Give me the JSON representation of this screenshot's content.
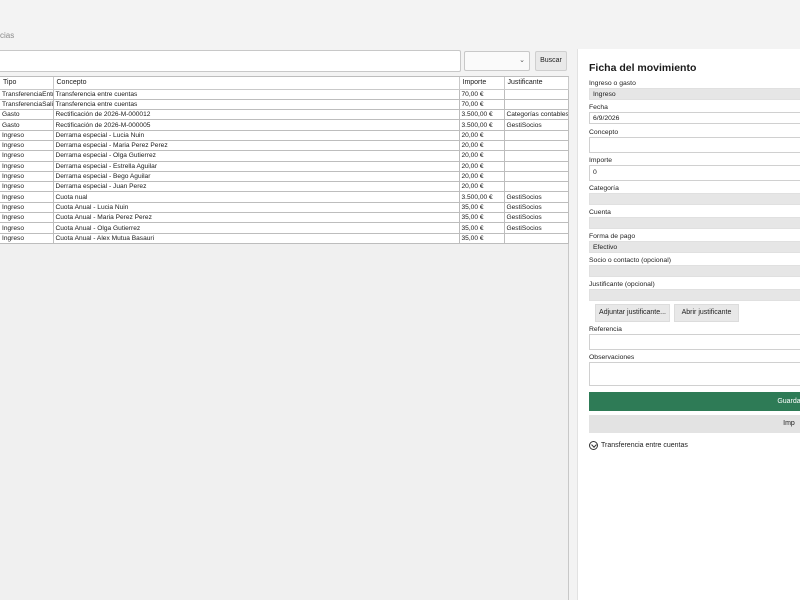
{
  "breadcrumb": "cias",
  "search": {
    "placeholder": "",
    "button": "Buscar",
    "filter_value": ""
  },
  "table": {
    "columns": [
      "Tipo",
      "Concepto",
      "Importe",
      "Justificante"
    ],
    "rows": [
      [
        "TransferenciaEntr",
        "Transferencia entre cuentas",
        "70,00 €",
        ""
      ],
      [
        "TransferenciaSalid",
        "Transferencia entre cuentas",
        "70,00 €",
        ""
      ],
      [
        "Gasto",
        "Rectificación de 2026-M-000012",
        "3.500,00 €",
        "Categorías contables"
      ],
      [
        "Gasto",
        "Rectificación de 2026-M-000005",
        "3.500,00 €",
        "GestiSocios"
      ],
      [
        "Ingreso",
        "Derrama  especial - Lucia Nuin",
        "20,00 €",
        ""
      ],
      [
        "Ingreso",
        "Derrama  especial - Maria Perez Perez",
        "20,00 €",
        ""
      ],
      [
        "Ingreso",
        "Derrama  especial - Olga Gutierrez",
        "20,00 €",
        ""
      ],
      [
        "Ingreso",
        "Derrama  especial - Estrella Aguilar",
        "20,00 €",
        ""
      ],
      [
        "Ingreso",
        "Derrama  especial - Bego Aguilar",
        "20,00 €",
        ""
      ],
      [
        "Ingreso",
        "Derrama  especial - Juan Perez",
        "20,00 €",
        ""
      ],
      [
        "Ingreso",
        "Cuota nual",
        "3.500,00 €",
        "GestiSocios"
      ],
      [
        "Ingreso",
        "Cuota Anual - Lucia Nuin",
        "35,00 €",
        "GestiSocios"
      ],
      [
        "Ingreso",
        "Cuota Anual - Maria Perez Perez",
        "35,00 €",
        "GestiSocios"
      ],
      [
        "Ingreso",
        "Cuota Anual - Olga Gutierrez",
        "35,00 €",
        "GestiSocios"
      ],
      [
        "Ingreso",
        "Cuota Anual - Alex Mutua Basauri",
        "35,00 €",
        ""
      ]
    ]
  },
  "panel": {
    "title": "Ficha del movimiento",
    "ingreso_label": "Ingreso o gasto",
    "ingreso_value": "Ingreso",
    "fecha_label": "Fecha",
    "fecha_value": "6/9/2026",
    "concepto_label": "Concepto",
    "concepto_value": "",
    "importe_label": "Importe",
    "importe_value": "0",
    "categoria_label": "Categoría",
    "categoria_value": "",
    "cuenta_label": "Cuenta",
    "cuenta_value": "",
    "forma_label": "Forma de pago",
    "forma_value": "Efectivo",
    "socio_label": "Socio o contacto (opcional)",
    "socio_value": "",
    "justificante_label": "Justificante (opcional)",
    "justificante_value": "",
    "adjuntar_button": "Adjuntar justificante...",
    "abrir_button": "Abrir justificante",
    "referencia_label": "Referencia",
    "referencia_value": "",
    "observaciones_label": "Observaciones",
    "observaciones_value": "",
    "guardar_button": "Guarda",
    "imprimir_button": "Imp",
    "transfer_expander": "Transferencia entre cuentas"
  },
  "colors": {
    "save": "#2e7b56",
    "panel_bg": "#ffffff",
    "app_bg": "#f3f3f3"
  }
}
